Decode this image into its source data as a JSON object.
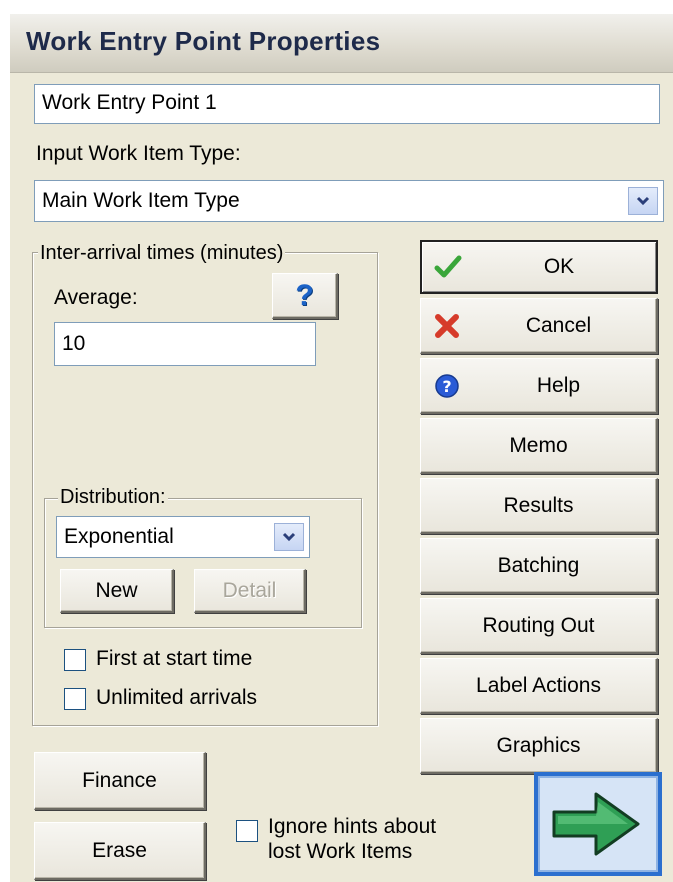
{
  "window": {
    "title": "Work Entry Point Properties"
  },
  "name_field": {
    "value": "Work Entry Point 1"
  },
  "work_item_type": {
    "label": "Input Work Item Type:",
    "selected": "Main Work Item Type"
  },
  "inter_arrival": {
    "group_label": "Inter-arrival times (minutes)",
    "average_label": "Average:",
    "average_value": "10",
    "help_glyph": "?",
    "distribution": {
      "group_label": "Distribution:",
      "selected": "Exponential",
      "new_label": "New",
      "detail_label": "Detail"
    },
    "first_at_start_label": "First at start time",
    "unlimited_label": "Unlimited arrivals"
  },
  "buttons": {
    "ok": "OK",
    "cancel": "Cancel",
    "help": "Help",
    "memo": "Memo",
    "results": "Results",
    "batching": "Batching",
    "routing_out": "Routing Out",
    "label_actions": "Label Actions",
    "graphics": "Graphics",
    "finance": "Finance",
    "erase": "Erase"
  },
  "ignore_hints": {
    "line1": "Ignore hints about",
    "line2": "lost Work Items"
  },
  "icons": {
    "ok": "green-check-icon",
    "cancel": "red-x-icon",
    "help": "blue-question-circle-icon",
    "next": "green-right-arrow-icon",
    "average_help": "question-mark-icon",
    "dropdown": "chevron-down-icon"
  },
  "colors": {
    "dialog_bg": "#ece9d8",
    "title_text": "#1e2a4a",
    "check_green": "#3aa63a",
    "cancel_red": "#d63b2a",
    "help_blue": "#2a5bd6",
    "arrow_green": "#2f9f55"
  }
}
